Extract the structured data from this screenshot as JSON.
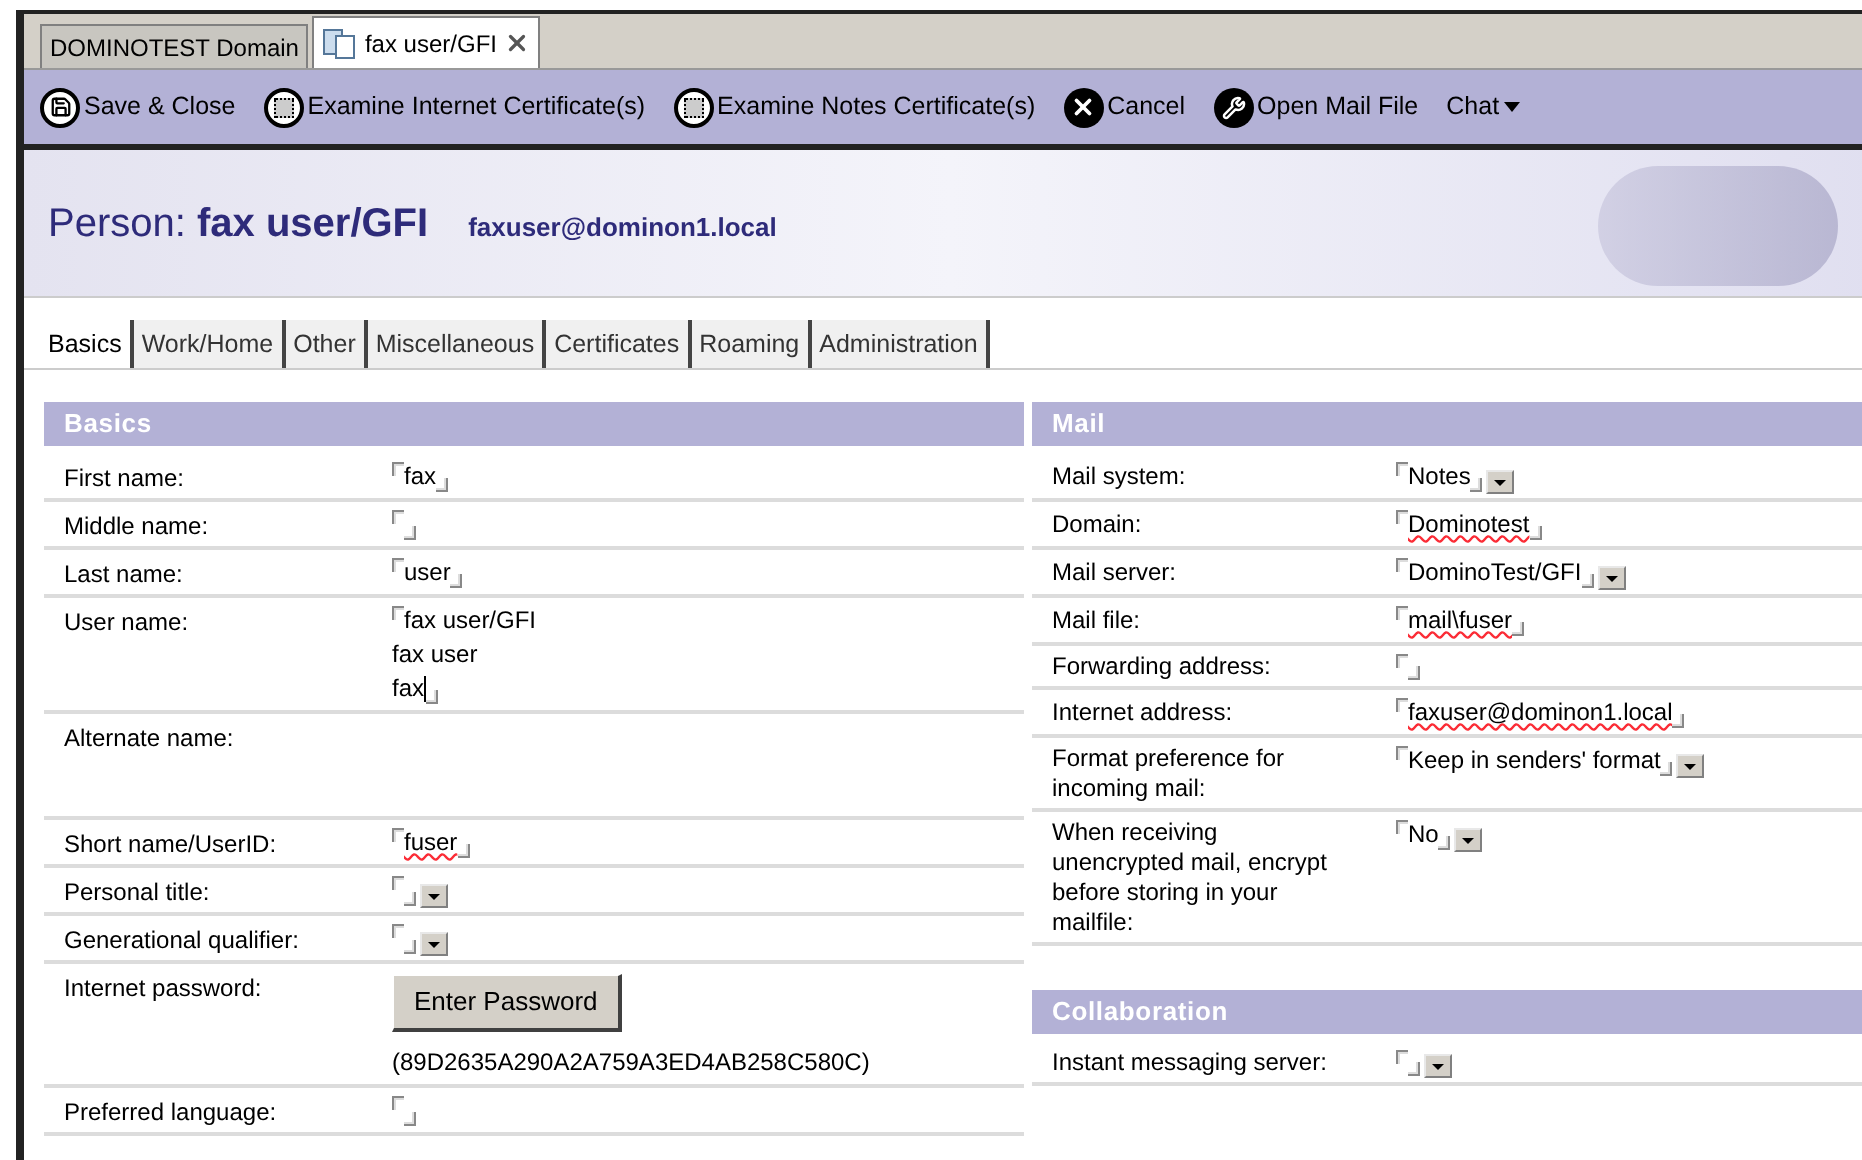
{
  "window_tabs": [
    {
      "label": "DOMINOTEST Domain",
      "selected": false
    },
    {
      "label": "fax user/GFI",
      "selected": true,
      "closable": true
    }
  ],
  "toolbar": [
    {
      "label": "Save & Close",
      "kind": "save"
    },
    {
      "label": "Examine Internet Certificate(s)",
      "kind": "certificate"
    },
    {
      "label": "Examine Notes Certificate(s)",
      "kind": "certificate"
    },
    {
      "label": "Cancel",
      "kind": "cancel"
    },
    {
      "label": "Open Mail File",
      "kind": "wrench"
    },
    {
      "label": "Chat",
      "kind": "menu"
    }
  ],
  "header": {
    "title": "Person: **fax user/GFI**",
    "email": "faxuser@dominon1.local"
  },
  "tabs": [
    {
      "label": "Basics",
      "selected": true
    },
    {
      "label": "Work/Home",
      "selected": false
    },
    {
      "label": "Other",
      "selected": false
    },
    {
      "label": "Miscellaneous",
      "selected": false
    },
    {
      "label": "Certificates",
      "selected": false
    },
    {
      "label": "Roaming",
      "selected": false
    },
    {
      "label": "Administration",
      "selected": false
    }
  ],
  "left_sections": [
    {
      "title": "Basics",
      "fields": [
        {
          "label": "First name:",
          "kind": "text",
          "lines": [
            "fax"
          ]
        },
        {
          "label": "Middle name:",
          "kind": "text"
        },
        {
          "label": "Last name:",
          "kind": "text",
          "lines": [
            "user"
          ]
        },
        {
          "label": "User name:",
          "kind": "text",
          "lines": [
            "fax user/GFI",
            "fax user",
            "fax"
          ],
          "cursor": true
        },
        {
          "label": "Alternate name:",
          "kind": "blank"
        },
        {
          "label": "Short name/UserID:",
          "kind": "text",
          "lines": [
            "fuser"
          ],
          "misspelled": true
        },
        {
          "label": "Personal title:",
          "kind": "dropdown"
        },
        {
          "label": "Generational qualifier:",
          "kind": "dropdown"
        },
        {
          "label": "Internet password:",
          "kind": "password",
          "button": "Enter Password",
          "hash": "(89D2635A290A2A759A3ED4AB258C580C)"
        },
        {
          "label": "Preferred language:",
          "kind": "text"
        }
      ]
    }
  ],
  "right_sections": [
    {
      "title": "Mail",
      "fields": [
        {
          "label": "Mail system:",
          "kind": "dropdown",
          "lines": [
            "Notes"
          ]
        },
        {
          "label": "Domain:",
          "kind": "text",
          "lines": [
            "Dominotest"
          ],
          "misspelled": true
        },
        {
          "label": "Mail server:",
          "kind": "dropdown",
          "lines": [
            "DominoTest/GFI"
          ]
        },
        {
          "label": "Mail file:",
          "kind": "text",
          "lines": [
            "mail\\fuser"
          ],
          "misspelled": true
        },
        {
          "label": "Forwarding address:",
          "kind": "text"
        },
        {
          "label": "Internet address:",
          "kind": "text",
          "lines": [
            "faxuser@dominon1.local"
          ],
          "misspelled": true
        },
        {
          "label": "Format preference for incoming mail:",
          "kind": "dropdown",
          "lines": [
            "Keep in senders' format"
          ]
        },
        {
          "label": "When receiving unencrypted mail, encrypt before storing in your mailfile:",
          "kind": "dropdown",
          "lines": [
            "No"
          ]
        }
      ]
    },
    {
      "title": "Collaboration",
      "fields": [
        {
          "label": "Instant messaging server:",
          "kind": "dropdown"
        }
      ]
    }
  ]
}
